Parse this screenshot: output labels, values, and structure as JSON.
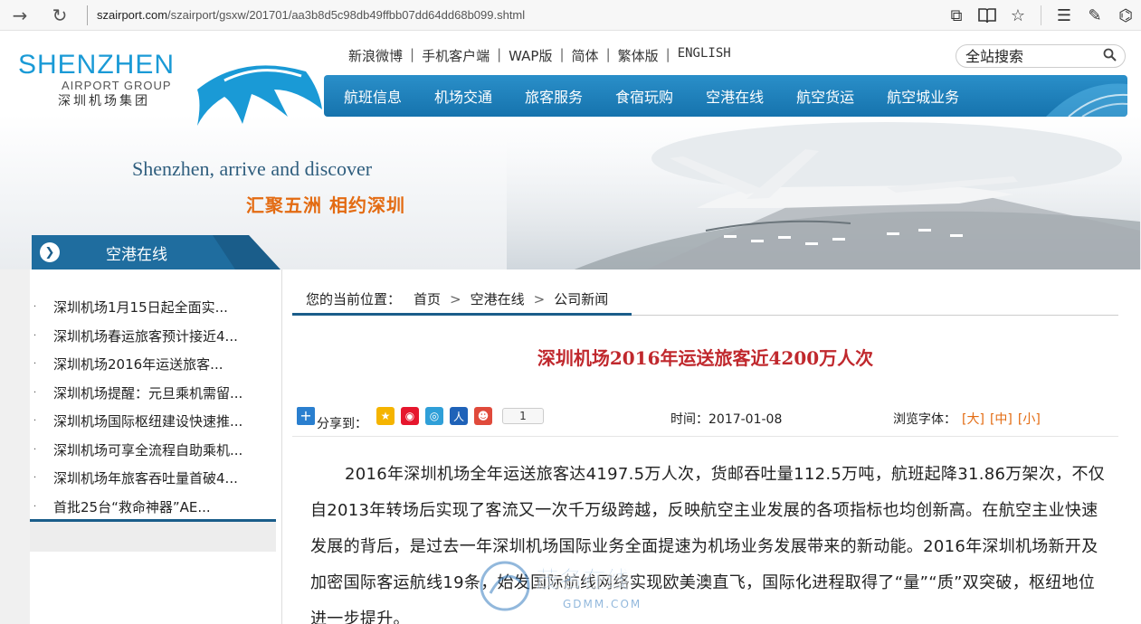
{
  "browser": {
    "url_host": "szairport.com",
    "url_path": "/szairport/gsxw/201701/aa3b8d5c98db49ffbb07dd64dd68b099.shtml"
  },
  "logo": {
    "en": "SHENZHEN",
    "group": "AIRPORT GROUP",
    "cn": "深圳机场集团"
  },
  "top_links": [
    "新浪微博",
    "手机客户端",
    "WAP版",
    "简体",
    "繁体版",
    "ENGLISH"
  ],
  "search": {
    "placeholder": "全站搜索"
  },
  "main_nav": [
    "航班信息",
    "机场交通",
    "旅客服务",
    "食宿玩购",
    "空港在线",
    "航空货运",
    "航空城业务"
  ],
  "banner": {
    "slogan_en": "Shenzhen, arrive and discover",
    "slogan_cn": "汇聚五洲  相约深圳"
  },
  "section": {
    "title": "空港在线"
  },
  "sidebar": {
    "items": [
      "深圳机场1月15日起全面实...",
      "深圳机场春运旅客预计接近4...",
      "深圳机场2016年运送旅客...",
      "深圳机场提醒：元旦乘机需留...",
      "深圳机场国际枢纽建设快速推...",
      "深圳机场可享全流程自助乘机...",
      "深圳机场年旅客吞吐量首破4...",
      "首批25台“救命神器”AE..."
    ]
  },
  "breadcrumb": {
    "prefix": "您的当前位置：",
    "items": [
      "首页",
      "空港在线",
      "公司新闻"
    ]
  },
  "article": {
    "title": "深圳机场2016年运送旅客近4200万人次",
    "share_label": "分享到：",
    "share_count": "1",
    "time_label": "时间：2017-01-08",
    "font_label": "浏览字体：",
    "font_options": [
      "[大]",
      "[中]",
      "[小]"
    ],
    "body": "2016年深圳机场全年运送旅客达4197.5万人次，货邮吞吐量112.5万吨，航班起降31.86万架次，不仅自2013年转场后实现了客流又一次千万级跨越，反映航空主业发展的各项指标也均创新高。在航空主业快速发展的背后，是过去一年深圳机场国际业务全面提速为机场业务发展带来的新动能。2016年深圳机场新开及加密国际客运航线19条，始发国际航线网络实现欧美澳直飞，国际化进程取得了“量”“质”双突破，枢纽地位进一步提升。"
  },
  "watermark": {
    "text": "茂名在线",
    "sub": "GDMM.COM"
  },
  "colors": {
    "brand_blue": "#1a9ad6",
    "nav_blue": "#1673ad",
    "title_red": "#c0282d",
    "accent_orange": "#e36b12"
  }
}
